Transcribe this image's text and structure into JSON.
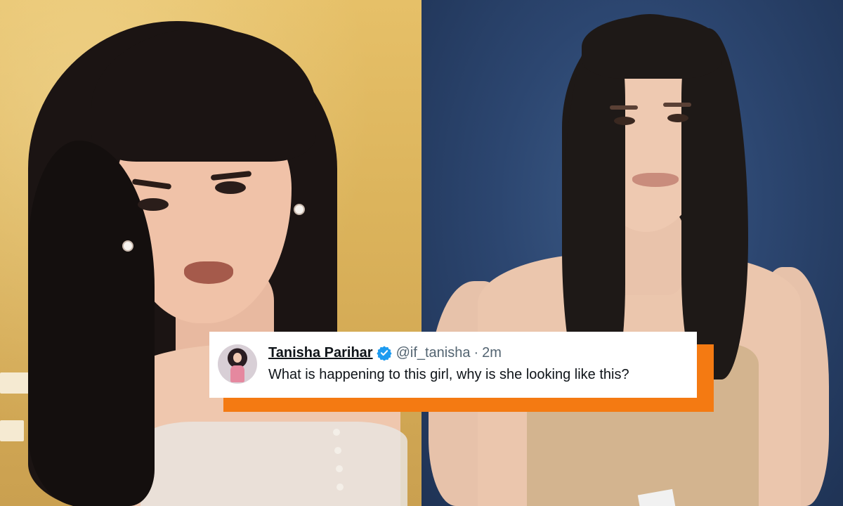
{
  "tweet": {
    "display_name": "Tanisha Parihar",
    "handle": "@if_tanisha",
    "separator": "·",
    "time": "2m",
    "text": "What is happening to this girl, why is she looking like this?",
    "verified_icon": "verified-badge-icon",
    "accent_color": "#1d9bf0",
    "highlight_color": "#f47a12"
  }
}
